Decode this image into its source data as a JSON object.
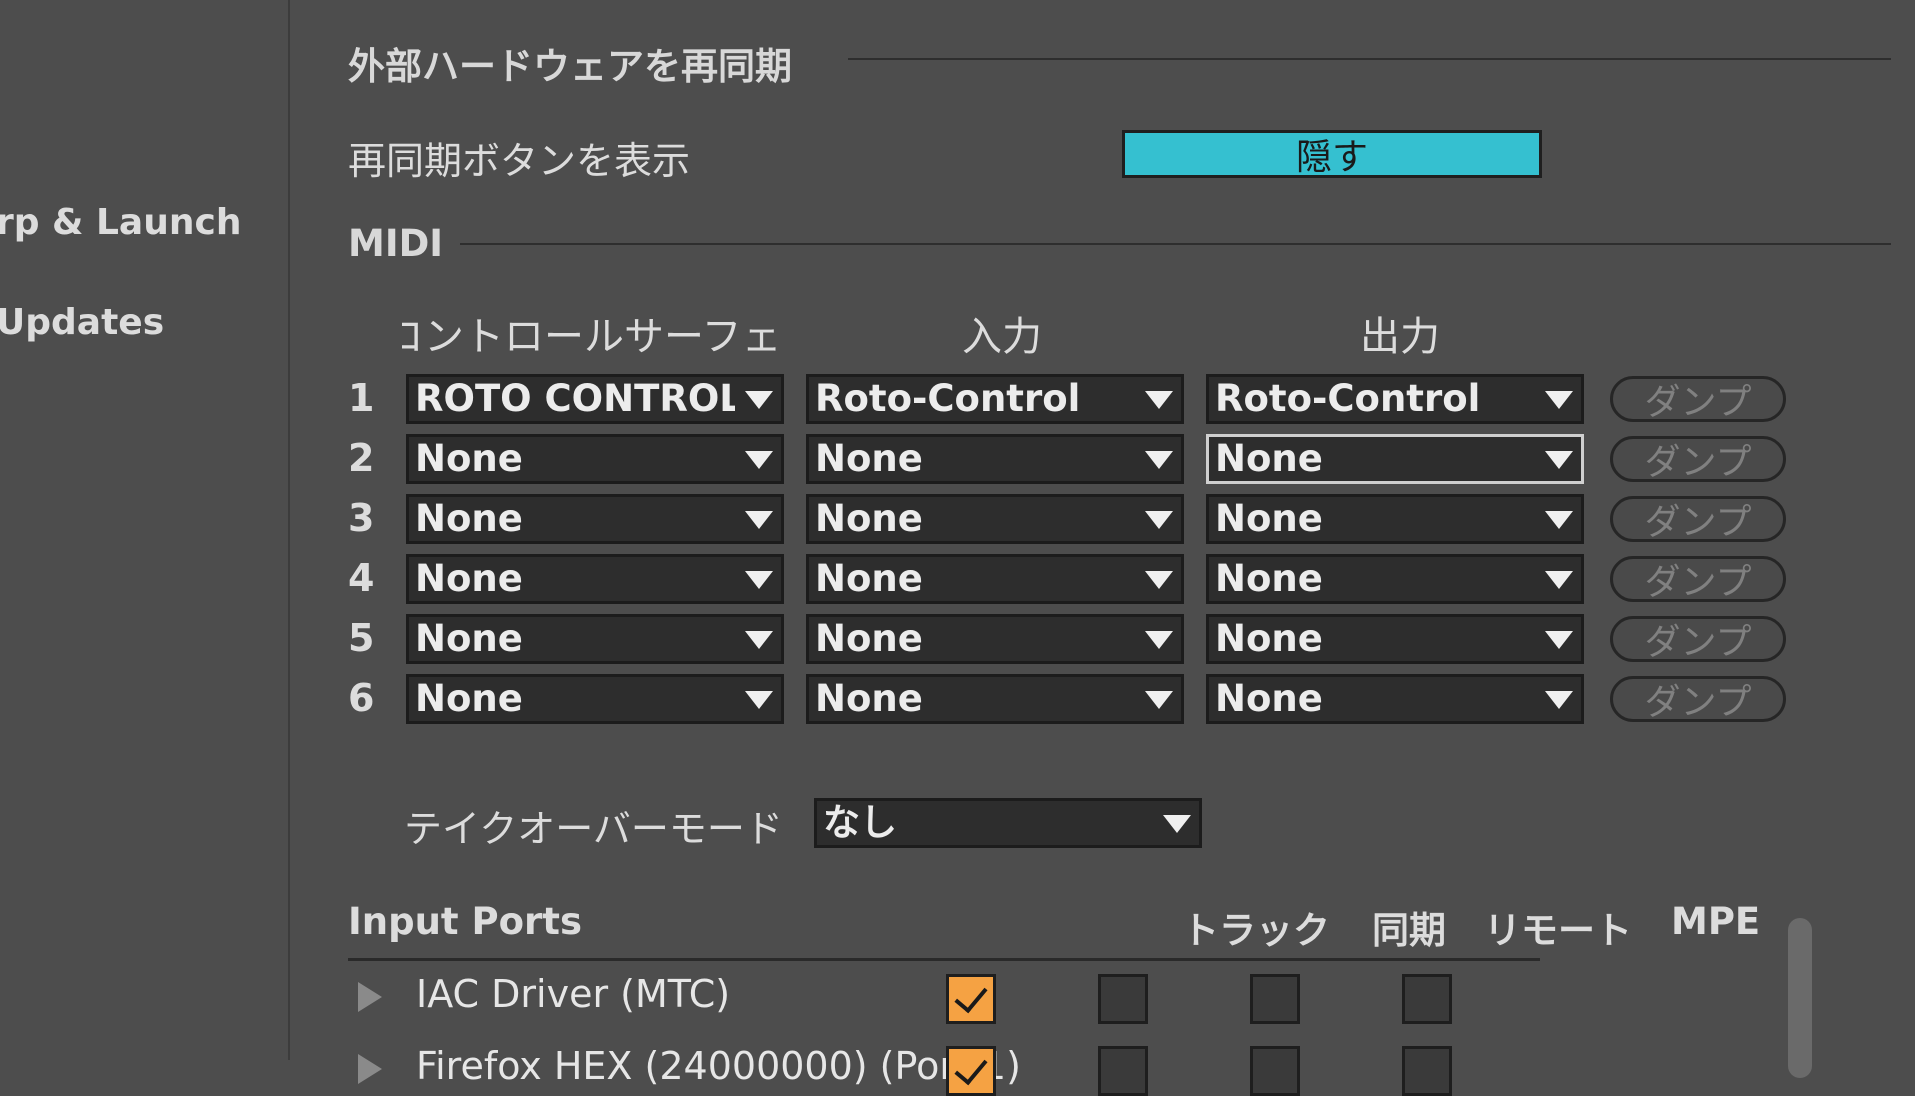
{
  "sidebar": {
    "items": [
      {
        "label": "rp & Launch"
      },
      {
        "label": "Updates"
      }
    ]
  },
  "resync": {
    "section_title": "外部ハードウェアを再同期",
    "show_label": "再同期ボタンを表示",
    "toggle_value": "隠す"
  },
  "midi": {
    "section_title": "MIDI",
    "headers": {
      "surface": "コントロールサーフェス",
      "input": "入力",
      "output": "出力"
    },
    "dump_label": "ダンプ",
    "rows": [
      {
        "num": "1",
        "surface": "ROTO CONTROL",
        "input": "Roto-Control",
        "output": "Roto-Control"
      },
      {
        "num": "2",
        "surface": "None",
        "input": "None",
        "output": "None"
      },
      {
        "num": "3",
        "surface": "None",
        "input": "None",
        "output": "None"
      },
      {
        "num": "4",
        "surface": "None",
        "input": "None",
        "output": "None"
      },
      {
        "num": "5",
        "surface": "None",
        "input": "None",
        "output": "None"
      },
      {
        "num": "6",
        "surface": "None",
        "input": "None",
        "output": "None"
      }
    ],
    "takeover_label": "テイクオーバーモード",
    "takeover_value": "なし"
  },
  "ports": {
    "title": "Input Ports",
    "cols": [
      "トラック",
      "同期",
      "リモート",
      "MPE"
    ],
    "rows": [
      {
        "name": "IAC Driver (MTC)",
        "track": true,
        "sync": false,
        "remote": false,
        "mpe": false
      },
      {
        "name": "Firefox HEX (24000000) (Port 1)",
        "track": true,
        "sync": false,
        "remote": false,
        "mpe": false
      }
    ]
  },
  "colors": {
    "accent_toggle": "#35c0d0",
    "checkbox_on": "#f5a243"
  }
}
